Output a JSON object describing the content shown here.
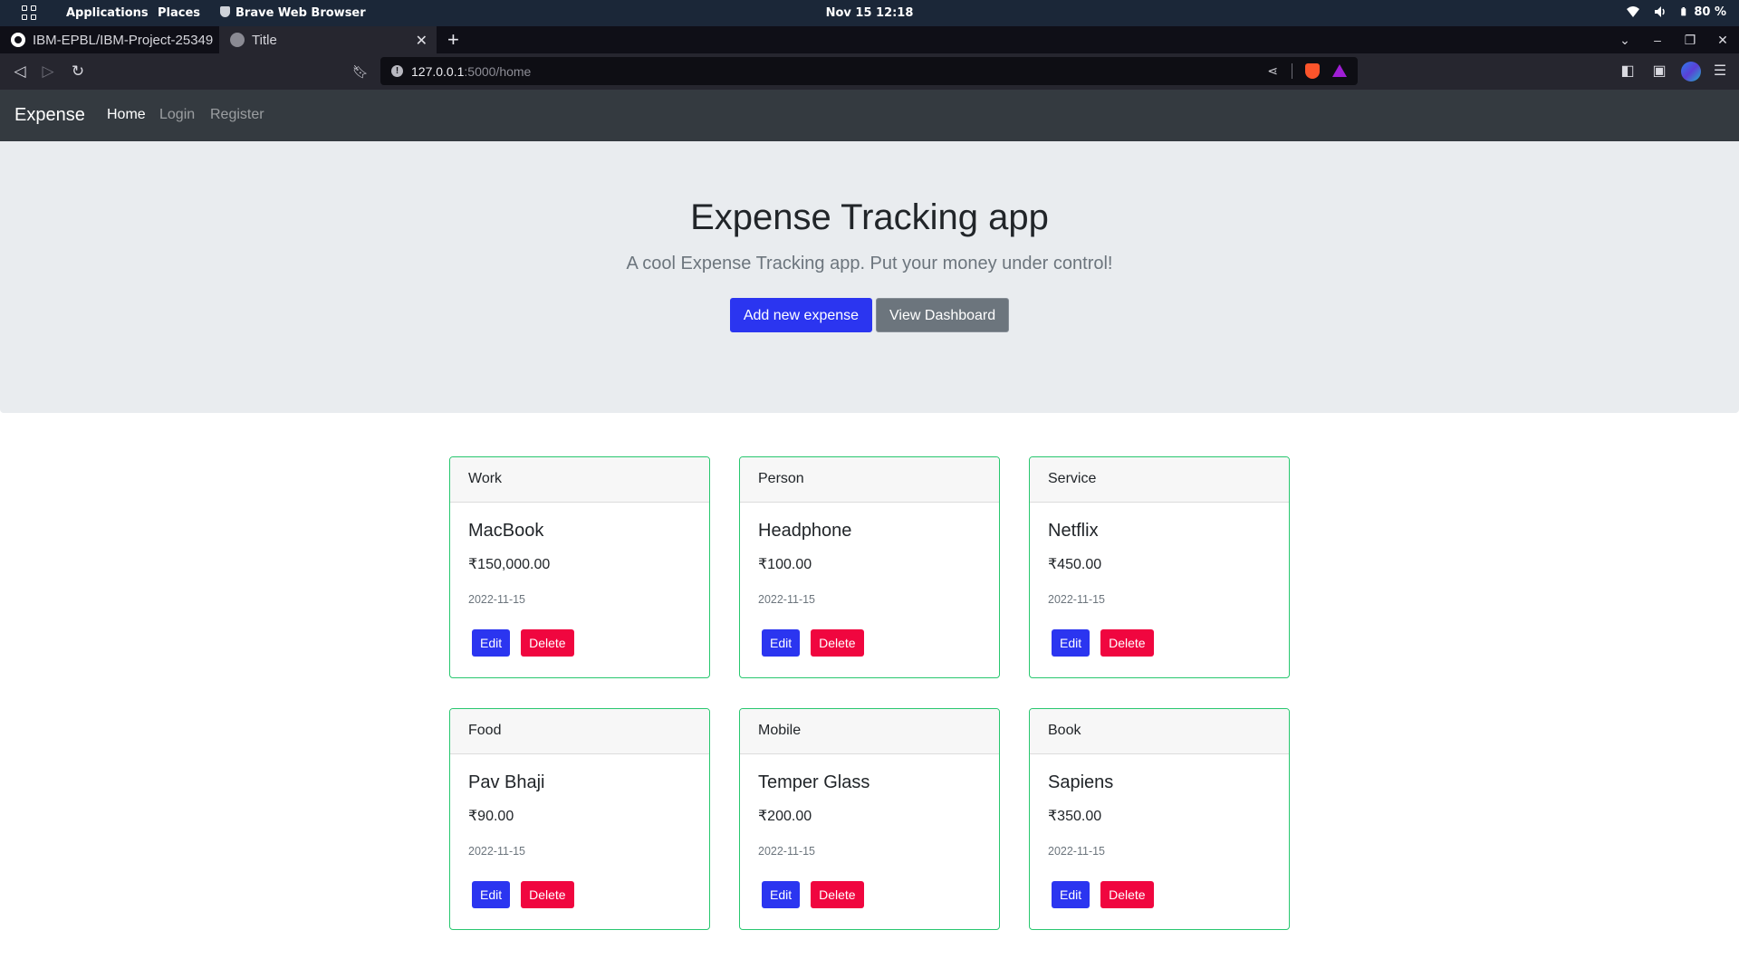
{
  "system": {
    "applications": "Applications",
    "places": "Places",
    "active_app": "Brave Web Browser",
    "datetime": "Nov 15  12:18",
    "battery": "80 %"
  },
  "browser": {
    "tabs": [
      {
        "label": "IBM-EPBL/IBM-Project-25349"
      },
      {
        "label": "Title"
      }
    ],
    "url_host": "127.0.0.1",
    "url_rest": ":5000/home"
  },
  "navbar": {
    "brand": "Expense",
    "links": [
      "Home",
      "Login",
      "Register"
    ]
  },
  "hero": {
    "title": "Expense Tracking app",
    "subtitle": "A cool Expense Tracking app. Put your money under control!",
    "primary_button": "Add new expense",
    "secondary_button": "View Dashboard"
  },
  "expenses": [
    {
      "category": "Work",
      "name": "MacBook",
      "amount": "₹150,000.00",
      "date": "2022-11-15",
      "edit": "Edit",
      "delete": "Delete"
    },
    {
      "category": "Person",
      "name": "Headphone",
      "amount": "₹100.00",
      "date": "2022-11-15",
      "edit": "Edit",
      "delete": "Delete"
    },
    {
      "category": "Service",
      "name": "Netflix",
      "amount": "₹450.00",
      "date": "2022-11-15",
      "edit": "Edit",
      "delete": "Delete"
    },
    {
      "category": "Food",
      "name": "Pav Bhaji",
      "amount": "₹90.00",
      "date": "2022-11-15",
      "edit": "Edit",
      "delete": "Delete"
    },
    {
      "category": "Mobile",
      "name": "Temper Glass",
      "amount": "₹200.00",
      "date": "2022-11-15",
      "edit": "Edit",
      "delete": "Delete"
    },
    {
      "category": "Book",
      "name": "Sapiens",
      "amount": "₹350.00",
      "date": "2022-11-15",
      "edit": "Edit",
      "delete": "Delete"
    }
  ],
  "colors": {
    "card_border": "#28c76f",
    "primary": "#2b35f0",
    "danger": "#f0063f",
    "navbar": "#343a40",
    "jumbotron": "#e9ecef"
  }
}
